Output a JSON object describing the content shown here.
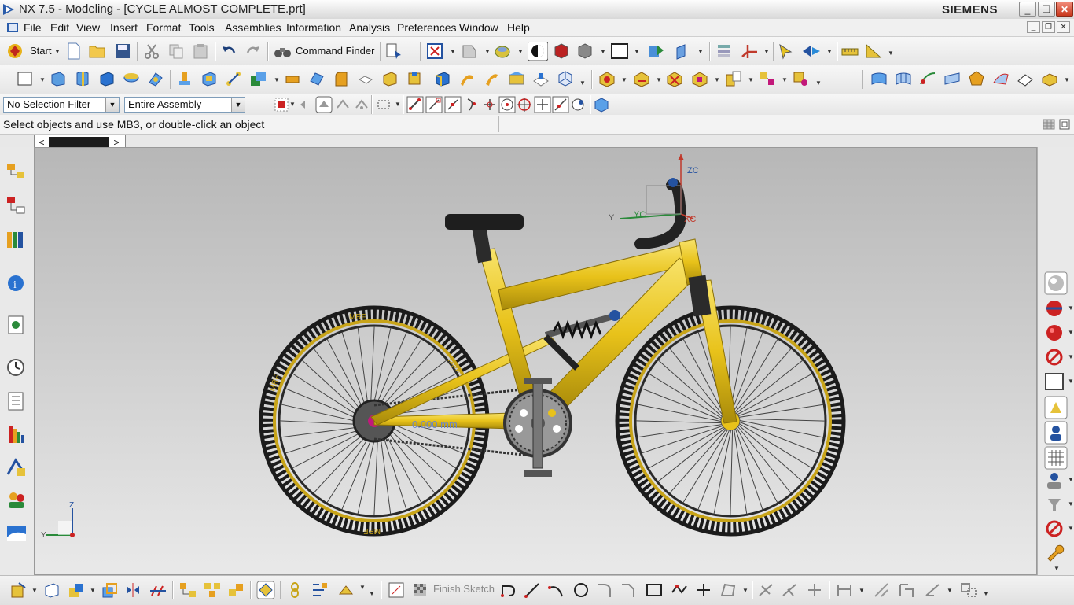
{
  "window": {
    "title": "NX 7.5 - Modeling - [CYCLE ALMOST COMPLETE.prt]",
    "brand": "SIEMENS",
    "minimize_label": "_",
    "maximize_label": "❐",
    "close_label": "✕"
  },
  "menubar": {
    "items": [
      {
        "label": "File"
      },
      {
        "label": "Edit"
      },
      {
        "label": "View"
      },
      {
        "label": "Insert"
      },
      {
        "label": "Format"
      },
      {
        "label": "Tools"
      },
      {
        "label": "Assemblies"
      },
      {
        "label": "Information"
      },
      {
        "label": "Analysis"
      },
      {
        "label": "Preferences"
      },
      {
        "label": "Window"
      },
      {
        "label": "Help"
      }
    ]
  },
  "toolbar": {
    "start_label": "Start",
    "command_finder_label": "Command Finder",
    "finish_sketch_label": "Finish Sketch"
  },
  "selection": {
    "filter_value": "No Selection Filter",
    "scope_value": "Entire Assembly"
  },
  "cue": {
    "text": "Select objects and use MB3, or double-click an object"
  },
  "viewport": {
    "wcs_labels": {
      "zc": "ZC",
      "yc": "YC",
      "xc": "XC",
      "y": "Y"
    },
    "triad_labels": {
      "z": "Z",
      "y": "Y"
    },
    "tire_brand": "MRF",
    "dimension_text": "0.000 mm"
  },
  "colors": {
    "frame": "#e8c21a",
    "frame_shadow": "#a88a0a",
    "tire": "#1b1b1b",
    "rim_stripe": "#c8a418",
    "viewport_top": "#b7b7b7",
    "viewport_bottom": "#e9e9e9"
  }
}
